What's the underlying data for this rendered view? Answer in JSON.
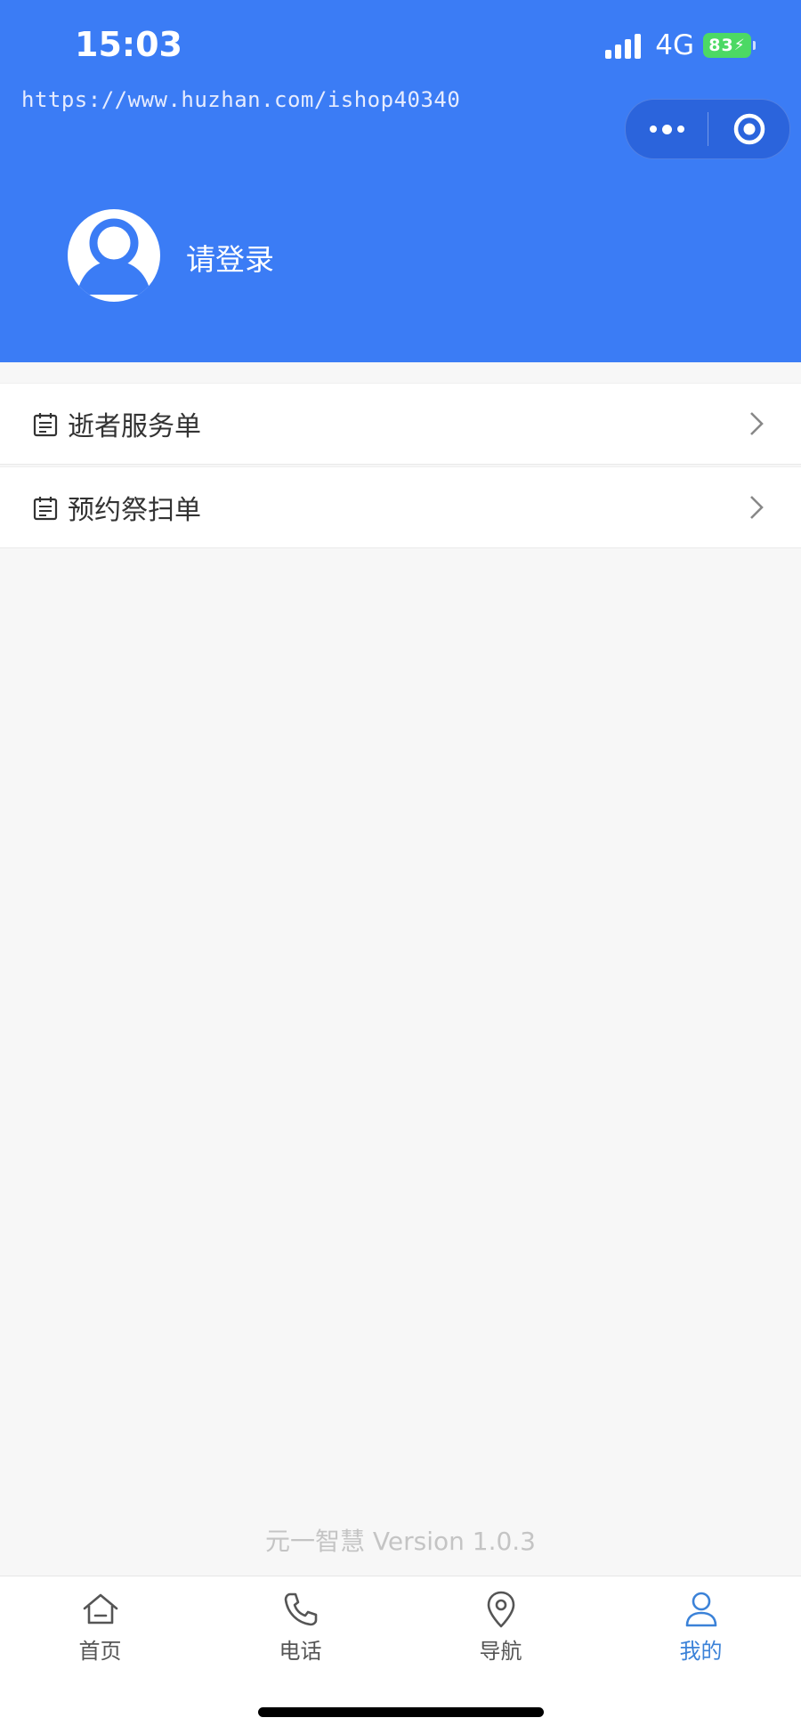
{
  "status_bar": {
    "time": "15:03",
    "network": "4G",
    "battery": "83"
  },
  "watermark": "https://www.huzhan.com/ishop40340",
  "mini_program_capsule": {
    "more_icon": "more-dots-icon",
    "close_icon": "target-close-icon"
  },
  "profile": {
    "avatar_icon": "user-avatar-icon",
    "login_label": "请登录"
  },
  "menu": {
    "items": [
      {
        "label": "逝者服务单",
        "icon": "order-list-icon"
      },
      {
        "label": "预约祭扫单",
        "icon": "order-list-icon"
      }
    ]
  },
  "footer": {
    "version": "元一智慧 Version 1.0.3"
  },
  "tabbar": {
    "tabs": [
      {
        "label": "首页",
        "icon": "home-icon",
        "active": false
      },
      {
        "label": "电话",
        "icon": "phone-icon",
        "active": false
      },
      {
        "label": "导航",
        "icon": "location-pin-icon",
        "active": false
      },
      {
        "label": "我的",
        "icon": "user-icon",
        "active": true
      }
    ]
  },
  "colors": {
    "header_blue": "#3b7cf5",
    "active_tab": "#3b82d8",
    "battery_green": "#4cd964",
    "page_bg": "#f7f7f7"
  }
}
